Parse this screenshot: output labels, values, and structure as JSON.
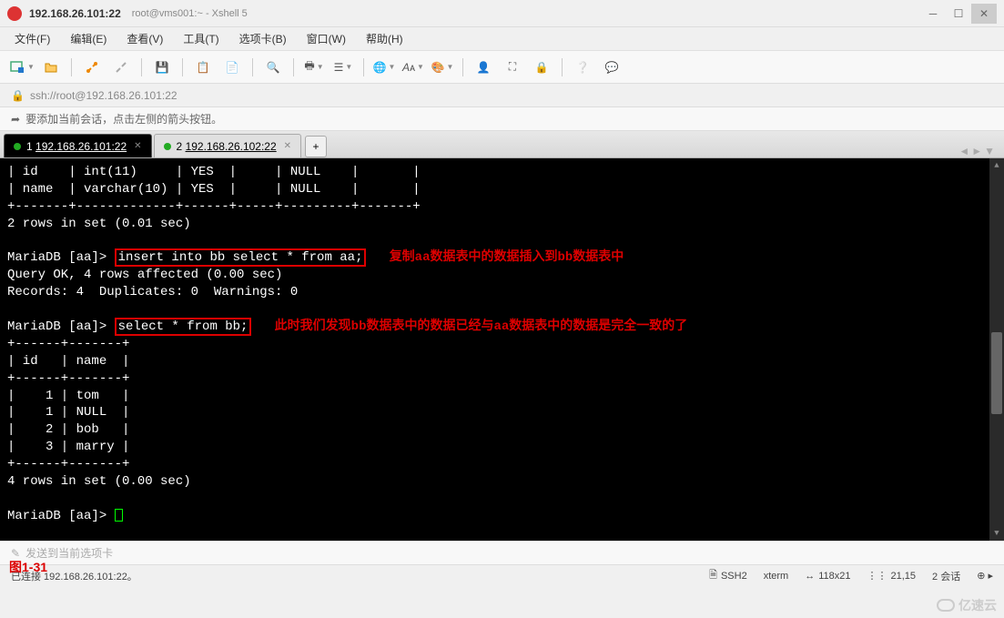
{
  "titlebar": {
    "title": "192.168.26.101:22",
    "subtitle": "root@vms001:~ - Xshell 5"
  },
  "menu": {
    "file": "文件(F)",
    "edit": "编辑(E)",
    "view": "查看(V)",
    "tools": "工具(T)",
    "tabs": "选项卡(B)",
    "window": "窗口(W)",
    "help": "帮助(H)"
  },
  "toolbar_icons": {
    "new": "new-tab-icon",
    "open": "open-icon",
    "link": "link-icon",
    "save": "save-icon",
    "copy": "copy-icon",
    "paste": "paste-icon",
    "search": "search-icon",
    "print": "print-icon",
    "props": "properties-icon",
    "globe": "globe-icon",
    "font": "font-icon",
    "palette": "palette-icon",
    "user": "user-icon",
    "fullscreen": "fullscreen-icon",
    "lock": "lock-icon",
    "help": "help-icon",
    "msg": "message-icon"
  },
  "address": {
    "url": "ssh://root@192.168.26.101:22"
  },
  "hint": {
    "text": "要添加当前会话，点击左侧的箭头按钮。"
  },
  "tabs": [
    {
      "index": "1",
      "label": "192.168.26.101:22",
      "active": true
    },
    {
      "index": "2",
      "label": "192.168.26.102:22",
      "active": false
    }
  ],
  "terminal": {
    "schema": [
      "| id    | int(11)     | YES  |     | NULL    |       |",
      "| name  | varchar(10) | YES  |     | NULL    |       |",
      "+-------+-------------+------+-----+---------+-------+"
    ],
    "rows_in_set_1": "2 rows in set (0.01 sec)",
    "prompt1": "MariaDB [aa]>",
    "cmd1": "insert into bb select * from aa;",
    "note1": "复制aa数据表中的数据插入到bb数据表中",
    "result1a": "Query OK, 4 rows affected (0.00 sec)",
    "result1b": "Records: 4  Duplicates: 0  Warnings: 0",
    "prompt2": "MariaDB [aa]>",
    "cmd2": "select * from bb;",
    "note2": "此时我们发现bb数据表中的数据已经与aa数据表中的数据是完全一致的了",
    "table_sep": "+------+-------+",
    "table_head": "| id   | name  |",
    "table_rows": [
      "|    1 | tom   |",
      "|    1 | NULL  |",
      "|    2 | bob   |",
      "|    3 | marry |"
    ],
    "rows_in_set_2": "4 rows in set (0.00 sec)",
    "prompt3": "MariaDB [aa]>"
  },
  "figure_label": "图1-31",
  "sendbar": {
    "placeholder": "发送到当前选项卡"
  },
  "status": {
    "left": "已连接 192.168.26.101:22。",
    "ssh": "SSH2",
    "term": "xterm",
    "size": "118x21",
    "pos": "21,15",
    "sessions": "2 会话"
  },
  "watermark": "亿速云"
}
